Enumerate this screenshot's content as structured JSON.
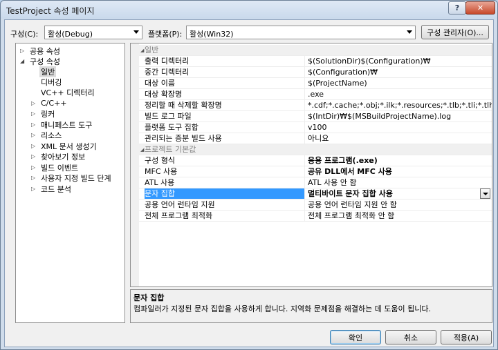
{
  "window": {
    "title": "TestProject 속성 페이지",
    "help_label": "?",
    "close_label": "✕"
  },
  "config": {
    "label": "구성(C):",
    "value": "활성(Debug)",
    "platform_label": "플랫폼(P):",
    "platform_value": "활성(Win32)",
    "manager_label": "구성 관리자(O)..."
  },
  "tree": [
    {
      "label": "공용 속성",
      "expander": "▷"
    },
    {
      "label": "구성 속성",
      "expander": "◢"
    },
    {
      "label": "일반",
      "expander": ""
    },
    {
      "label": "디버깅",
      "expander": ""
    },
    {
      "label": "VC++ 디렉터리",
      "expander": ""
    },
    {
      "label": "C/C++",
      "expander": "▷"
    },
    {
      "label": "링커",
      "expander": "▷"
    },
    {
      "label": "매니페스트 도구",
      "expander": "▷"
    },
    {
      "label": "리소스",
      "expander": "▷"
    },
    {
      "label": "XML 문서 생성기",
      "expander": "▷"
    },
    {
      "label": "찾아보기 정보",
      "expander": "▷"
    },
    {
      "label": "빌드 이벤트",
      "expander": "▷"
    },
    {
      "label": "사용자 지정 빌드 단계",
      "expander": "▷"
    },
    {
      "label": "코드 분석",
      "expander": "▷"
    }
  ],
  "grid": {
    "categories": [
      {
        "label": "일반",
        "expander": "◢"
      },
      {
        "label": "프로젝트 기본값",
        "expander": "◢"
      }
    ],
    "general": [
      {
        "name": "출력 디렉터리",
        "value": "$(SolutionDir)$(Configuration)₩"
      },
      {
        "name": "중간 디렉터리",
        "value": "$(Configuration)₩"
      },
      {
        "name": "대상 이름",
        "value": "$(ProjectName)"
      },
      {
        "name": "대상 확장명",
        "value": ".exe"
      },
      {
        "name": "정리할 때 삭제할 확장명",
        "value": "*.cdf;*.cache;*.obj;*.ilk;*.resources;*.tlb;*.tli;*.tlh;*.tmp;*.rsp;*"
      },
      {
        "name": "빌드 로그 파일",
        "value": "$(IntDir)₩$(MSBuildProjectName).log"
      },
      {
        "name": "플랫폼 도구 집합",
        "value": "v100"
      },
      {
        "name": "관리되는 증분 빌드 사용",
        "value": "아니요"
      }
    ],
    "defaults": [
      {
        "name": "구성 형식",
        "value": "응용 프로그램(.exe)"
      },
      {
        "name": "MFC 사용",
        "value": "공유 DLL에서 MFC 사용"
      },
      {
        "name": "ATL 사용",
        "value": "ATL 사용 안 함"
      },
      {
        "name": "문자 집합",
        "value": "멀티바이트 문자 집합 사용"
      },
      {
        "name": "공용 언어 런타임 지원",
        "value": "공용 언어 런타임 지원 안 함"
      },
      {
        "name": "전체 프로그램 최적화",
        "value": "전체 프로그램 최적화 안 함"
      }
    ]
  },
  "description": {
    "title": "문자 집합",
    "text": "컴파일러가 지정된 문자 집합을 사용하게 합니다. 지역화 문제점을 해결하는 데 도움이 됩니다."
  },
  "buttons": {
    "ok": "확인",
    "cancel": "취소",
    "apply": "적용(A)"
  }
}
